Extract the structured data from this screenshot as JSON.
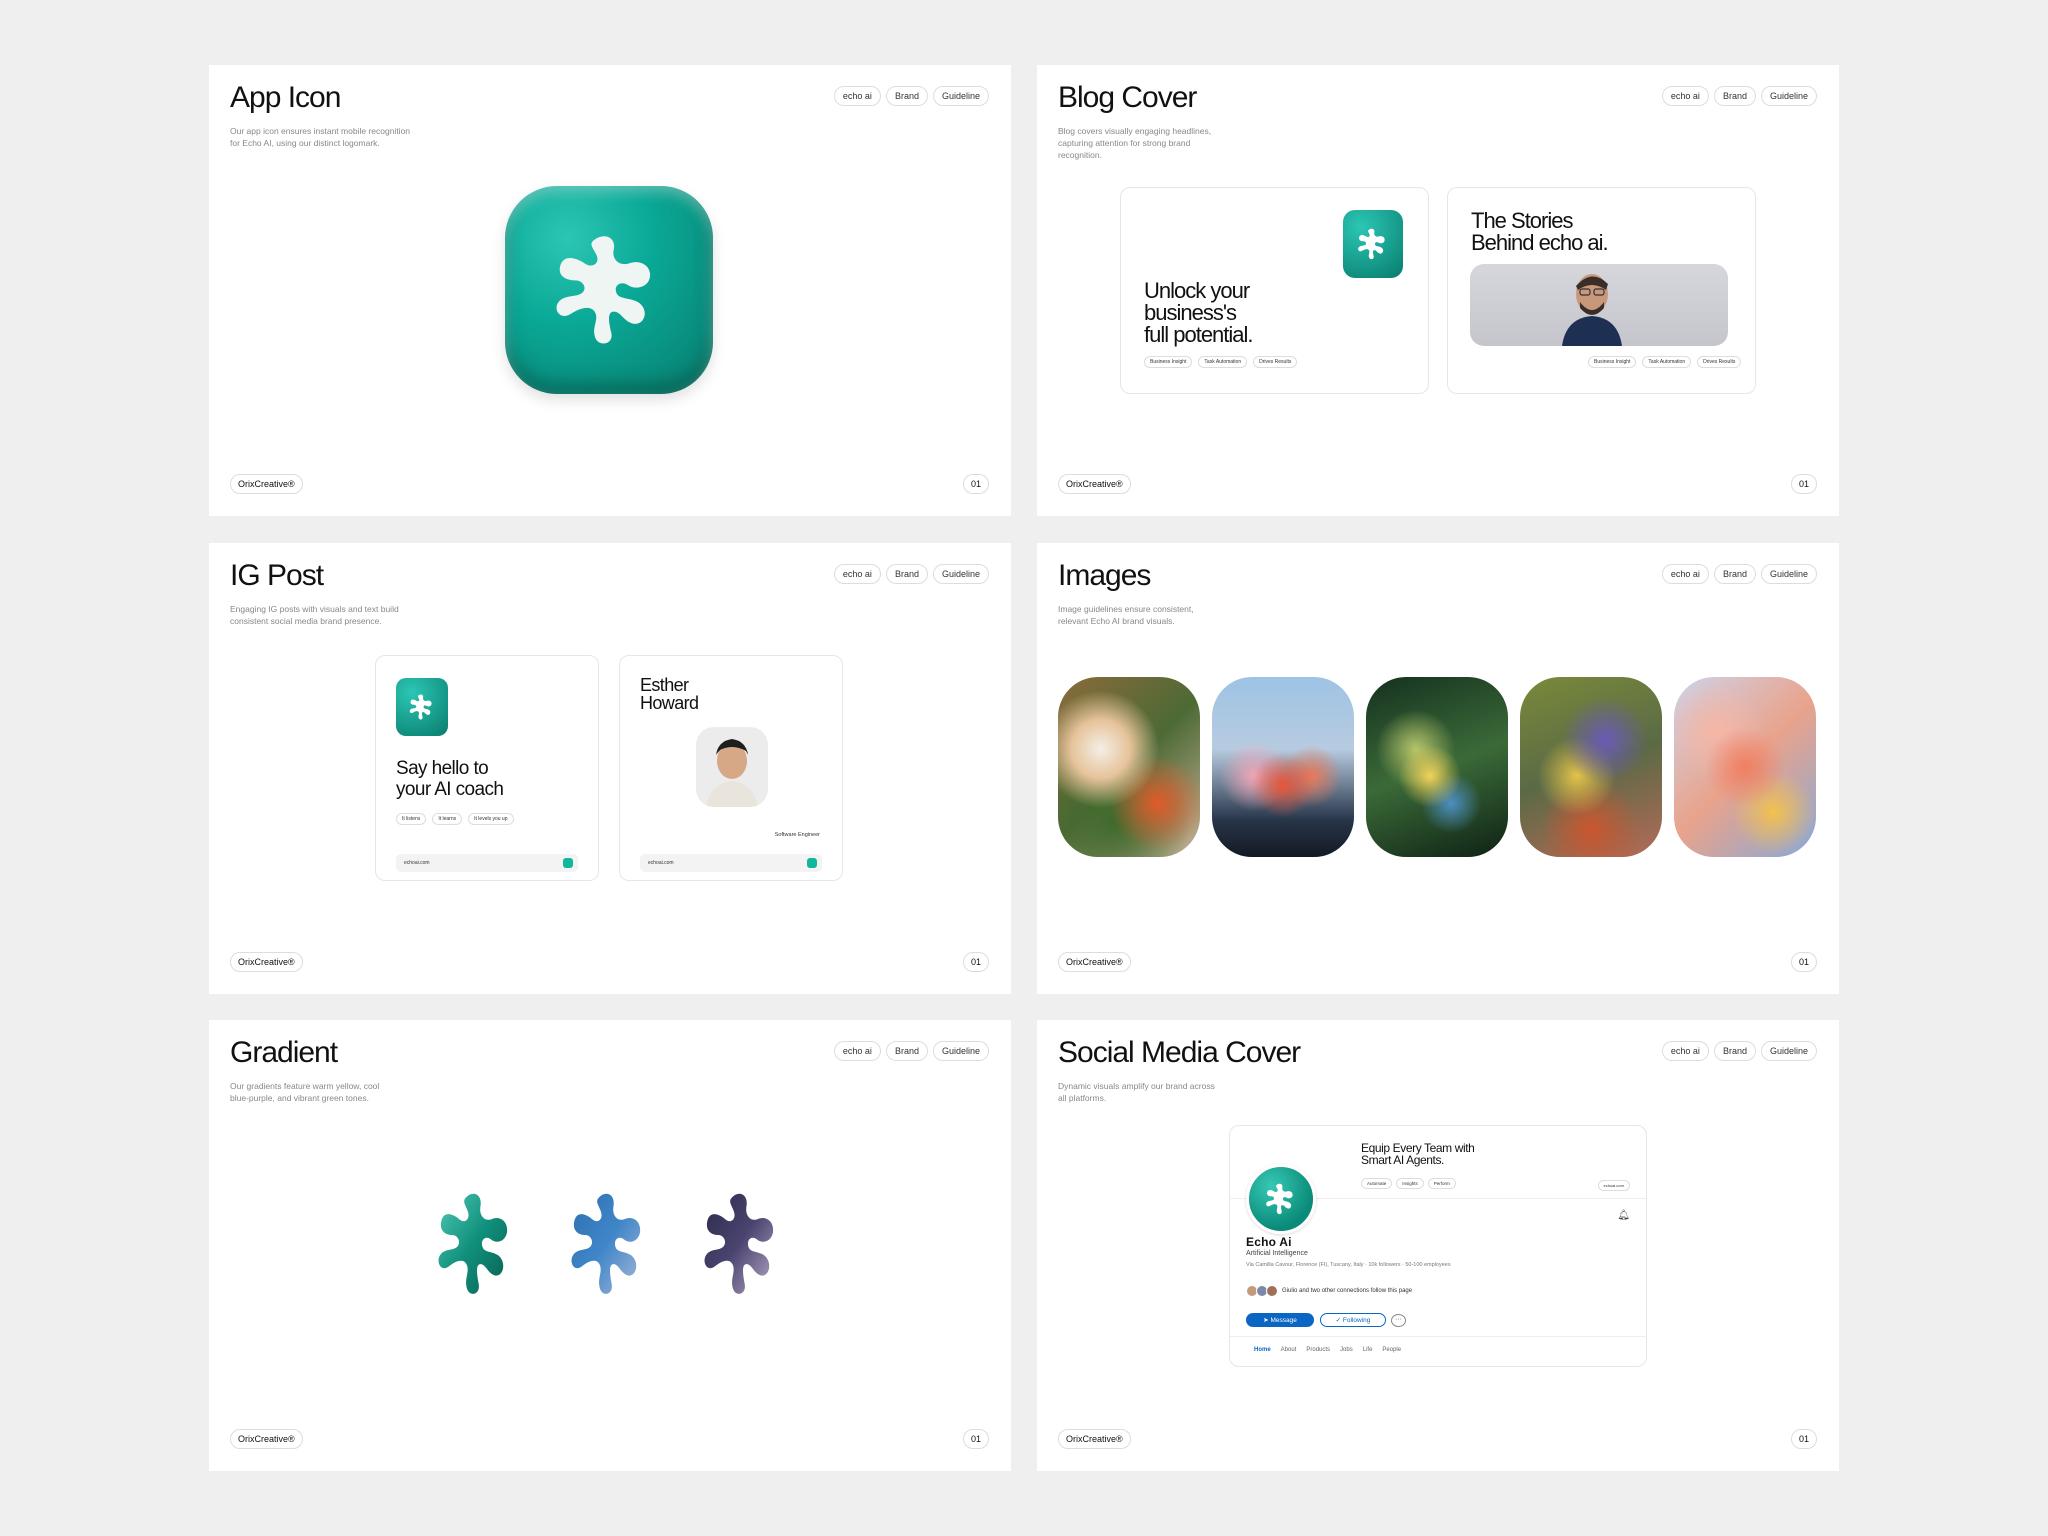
{
  "tags": [
    "echo ai",
    "Brand",
    "Guideline"
  ],
  "footer": {
    "brand": "OrixCreative®",
    "page": "01"
  },
  "colors": {
    "teal": "#0aa896",
    "linkedin_blue": "#0a66c2",
    "background": "#efefef"
  },
  "panels": {
    "app_icon": {
      "title": "App Icon",
      "description": "Our app icon ensures instant mobile recognition for Echo AI, using our distinct logomark."
    },
    "blog_cover": {
      "title": "Blog Cover",
      "description": "Blog covers visually engaging headlines, capturing attention for strong brand recognition.",
      "card1": {
        "headline_1": "Unlock your",
        "headline_2": "business's",
        "headline_3": "full potential.",
        "chips": [
          "Business Insight",
          "Task Automation",
          "Drives Results"
        ]
      },
      "card2": {
        "headline_1": "The Stories",
        "headline_2": "Behind echo ai.",
        "chips": [
          "Business Insight",
          "Task Automation",
          "Drives Results"
        ]
      }
    },
    "ig_post": {
      "title": "IG Post",
      "description": "Engaging IG posts with visuals and text build consistent social media brand presence.",
      "card1": {
        "headline_1": "Say hello to",
        "headline_2": "your AI coach",
        "chips": [
          "It listens",
          "It learns",
          "It levels you up"
        ],
        "url": "echoai.com"
      },
      "card2": {
        "name_1": "Esther",
        "name_2": "Howard",
        "role": "Software Engineer",
        "url": "echoai.com"
      }
    },
    "images": {
      "title": "Images",
      "description": "Image guidelines ensure consistent, relevant Echo AI brand visuals."
    },
    "gradient": {
      "title": "Gradient",
      "description": "Our gradients feature warm yellow, cool blue-purple, and vibrant green tones."
    },
    "social_media_cover": {
      "title": "Social Media Cover",
      "description": "Dynamic visuals amplify our brand across all platforms.",
      "banner_line_1": "Equip Every Team with",
      "banner_line_2": "Smart AI Agents.",
      "banner_chips": [
        "Automate",
        "Insights",
        "Perform"
      ],
      "banner_url": "echoai.com",
      "company": "Echo Ai",
      "industry": "Artificial Intelligence",
      "meta": "Via Camilla Cavour, Florence (FI), Tuscany, Italy · 10k followers · 50-100 employees",
      "connections": "Giulio and two other connections follow this page",
      "message_label": "Message",
      "following_label": "Following",
      "nav": [
        "Home",
        "About",
        "Products",
        "Jobs",
        "Life",
        "People"
      ]
    }
  }
}
